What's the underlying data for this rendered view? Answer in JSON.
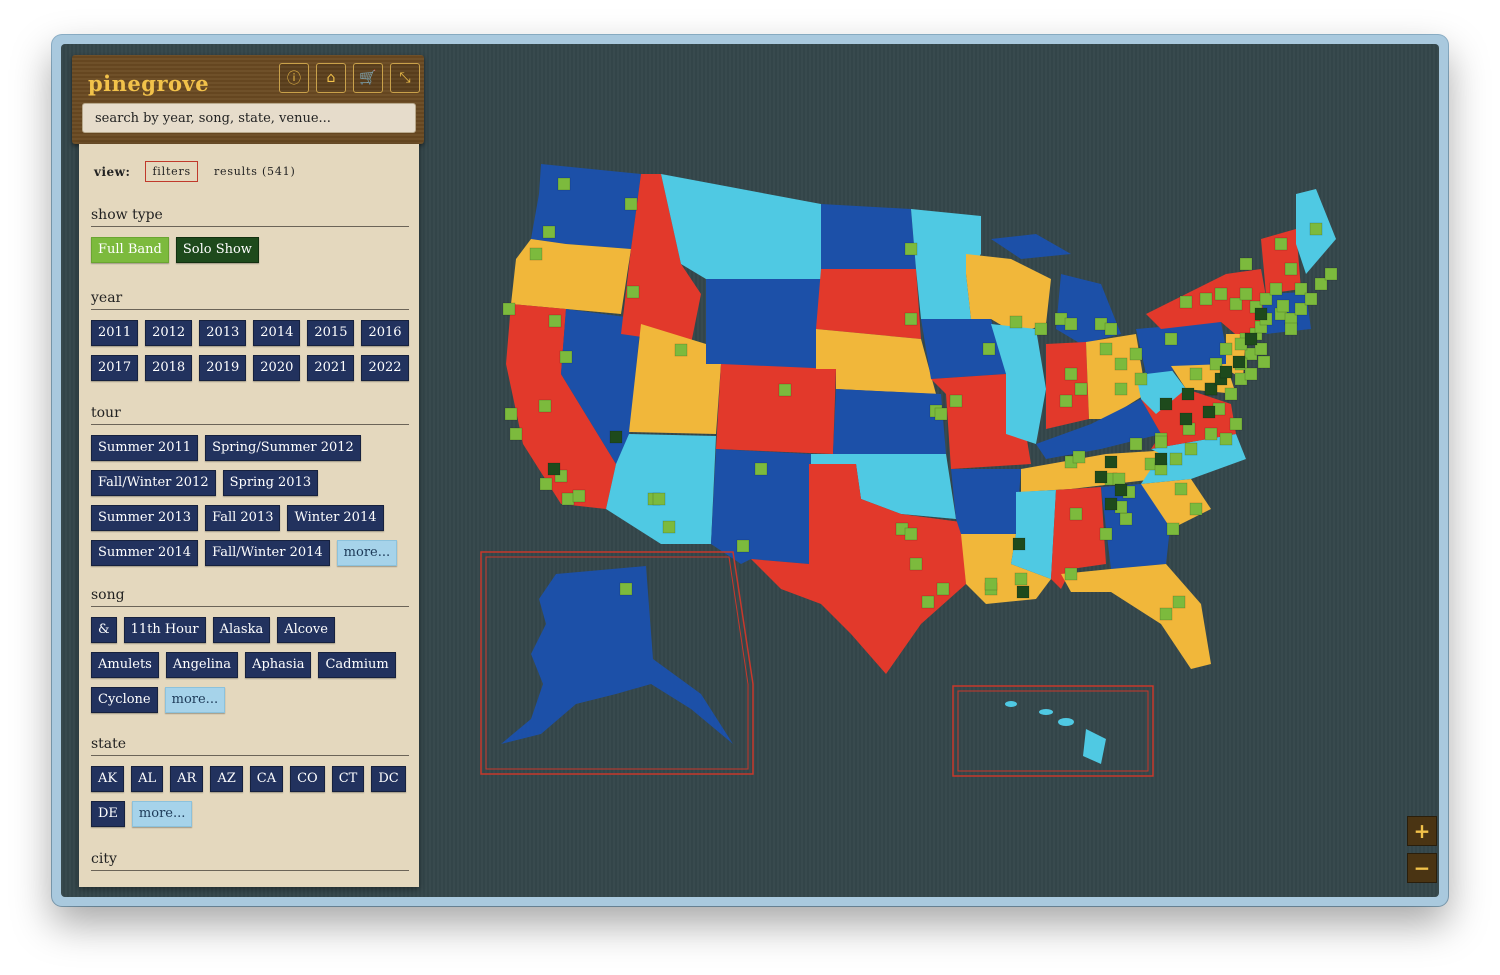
{
  "app": {
    "title": "pinegrove"
  },
  "header_buttons": [
    {
      "name": "info-button",
      "icon": "info-icon",
      "glyph": "ⓘ"
    },
    {
      "name": "home-button",
      "icon": "home-icon",
      "glyph": "⌂"
    },
    {
      "name": "cart-button",
      "icon": "cart-icon",
      "glyph": "🛒"
    },
    {
      "name": "collapse-button",
      "icon": "collapse-icon",
      "glyph": "⤡"
    }
  ],
  "search": {
    "placeholder": "search by year, song, state, venue..."
  },
  "view": {
    "label": "view:",
    "filters": "filters",
    "results": "results (541)"
  },
  "sections": {
    "show_type": {
      "title": "show type",
      "items": [
        "Full Band",
        "Solo Show"
      ]
    },
    "year": {
      "title": "year",
      "items": [
        "2011",
        "2012",
        "2013",
        "2014",
        "2015",
        "2016",
        "2017",
        "2018",
        "2019",
        "2020",
        "2021",
        "2022"
      ]
    },
    "tour": {
      "title": "tour",
      "items": [
        "Summer 2011",
        "Spring/Summer 2012",
        "Fall/Winter 2012",
        "Spring 2013",
        "Summer 2013",
        "Fall 2013",
        "Winter 2014",
        "Summer 2014",
        "Fall/Winter 2014"
      ],
      "more": "more..."
    },
    "song": {
      "title": "song",
      "items": [
        "&",
        "11th Hour",
        "Alaska",
        "Alcove",
        "Amulets",
        "Angelina",
        "Aphasia",
        "Cadmium",
        "Cyclone"
      ],
      "more": "more..."
    },
    "state": {
      "title": "state",
      "items": [
        "AK",
        "AL",
        "AR",
        "AZ",
        "CA",
        "CO",
        "CT",
        "DC",
        "DE"
      ],
      "more": "more..."
    },
    "city": {
      "title": "city"
    }
  },
  "zoom": {
    "in": "+",
    "out": "−"
  },
  "colors": {
    "red": "#e2392b",
    "navy": "#1c50a8",
    "sky": "#4fc9e3",
    "gold": "#f1b73a",
    "marker_full": "#7cba3d",
    "marker_solo": "#1e4a1c",
    "inset_border": "#c8382b"
  }
}
